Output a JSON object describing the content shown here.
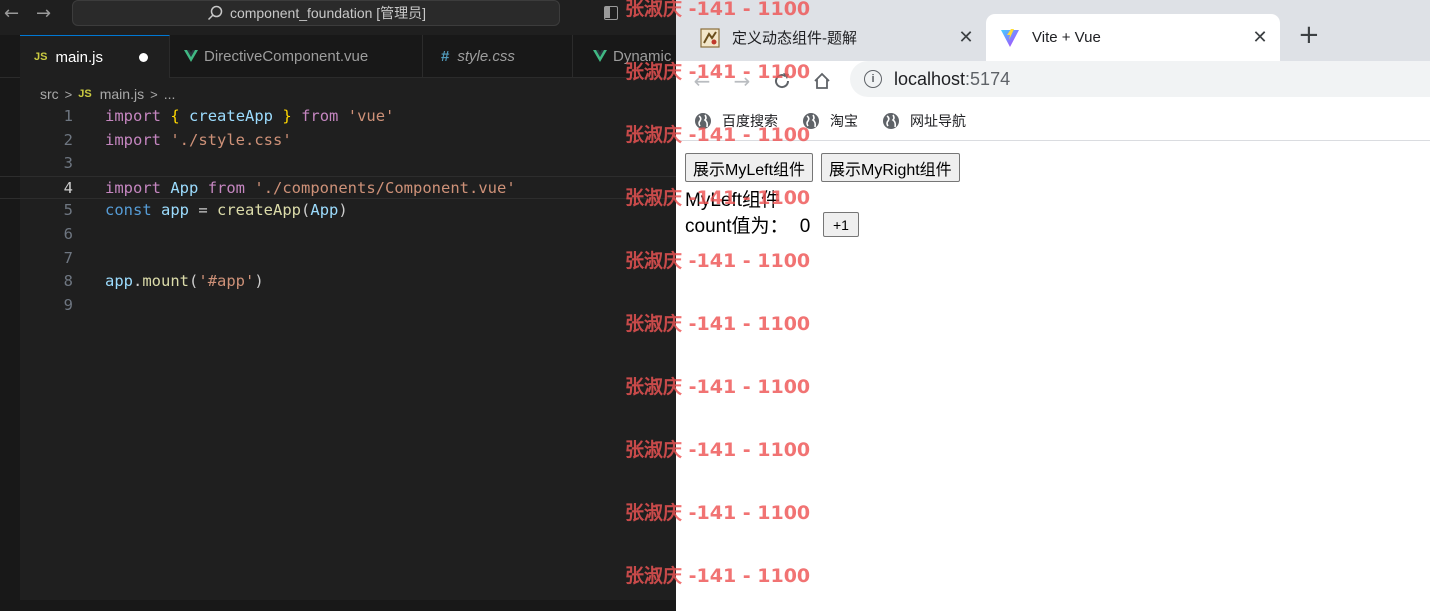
{
  "vscode": {
    "command_center": "component_foundation [管理员]",
    "tabs": [
      {
        "badge": "JS",
        "label": "main.js",
        "active": true,
        "modified": true
      },
      {
        "badge": "vue",
        "label": "DirectiveComponent.vue"
      },
      {
        "badge": "#",
        "label": "style.css"
      },
      {
        "badge": "vue",
        "label": "Dynamic"
      }
    ],
    "breadcrumb": {
      "folder": "src",
      "file_badge": "JS",
      "file": "main.js",
      "more": "..."
    },
    "current_line": 4,
    "code_lines": [
      {
        "n": "1",
        "tokens": [
          [
            "kw",
            "import"
          ],
          [
            "pun",
            " "
          ],
          [
            "brace",
            "{"
          ],
          [
            "pun",
            " "
          ],
          [
            "var",
            "createApp"
          ],
          [
            "pun",
            " "
          ],
          [
            "brace",
            "}"
          ],
          [
            "pun",
            " "
          ],
          [
            "kw",
            "from"
          ],
          [
            "pun",
            " "
          ],
          [
            "str",
            "'vue'"
          ]
        ]
      },
      {
        "n": "2",
        "tokens": [
          [
            "kw",
            "import"
          ],
          [
            "pun",
            " "
          ],
          [
            "str",
            "'./style.css'"
          ]
        ]
      },
      {
        "n": "3",
        "tokens": []
      },
      {
        "n": "4",
        "tokens": [
          [
            "kw",
            "import"
          ],
          [
            "pun",
            " "
          ],
          [
            "var",
            "App"
          ],
          [
            "pun",
            " "
          ],
          [
            "kw",
            "from"
          ],
          [
            "pun",
            " "
          ],
          [
            "str",
            "'./components/Component.vue'"
          ]
        ]
      },
      {
        "n": "5",
        "tokens": [
          [
            "kw2",
            "const"
          ],
          [
            "pun",
            " "
          ],
          [
            "var",
            "app"
          ],
          [
            "pun",
            " = "
          ],
          [
            "fn",
            "createApp"
          ],
          [
            "pun",
            "("
          ],
          [
            "var",
            "App"
          ],
          [
            "pun",
            ")"
          ]
        ]
      },
      {
        "n": "6",
        "tokens": []
      },
      {
        "n": "7",
        "tokens": []
      },
      {
        "n": "8",
        "tokens": [
          [
            "var",
            "app"
          ],
          [
            "pun",
            "."
          ],
          [
            "fn",
            "mount"
          ],
          [
            "pun",
            "("
          ],
          [
            "str",
            "'#app'"
          ],
          [
            "pun",
            ")"
          ]
        ]
      },
      {
        "n": "9",
        "tokens": []
      }
    ]
  },
  "browser": {
    "tabs": [
      {
        "title": "定义动态组件-题解",
        "active": false,
        "close": "✕"
      },
      {
        "title": "Vite + Vue",
        "active": true,
        "close": "✕"
      }
    ],
    "new_tab": "+",
    "url": {
      "host": "localhost",
      "port": ":5174"
    },
    "bookmarks": [
      "百度搜索",
      "淘宝",
      "网址导航"
    ],
    "page": {
      "buttons": [
        "展示MyLeft组件",
        "展示MyRight组件"
      ],
      "component_title": "MyLeft组件",
      "count_label": "count值为：",
      "count_value": "0",
      "increment_label": "+1"
    }
  },
  "watermark": {
    "text": "张淑庆 -141 - 1100",
    "repeat": 10,
    "color": "#ee5454"
  }
}
